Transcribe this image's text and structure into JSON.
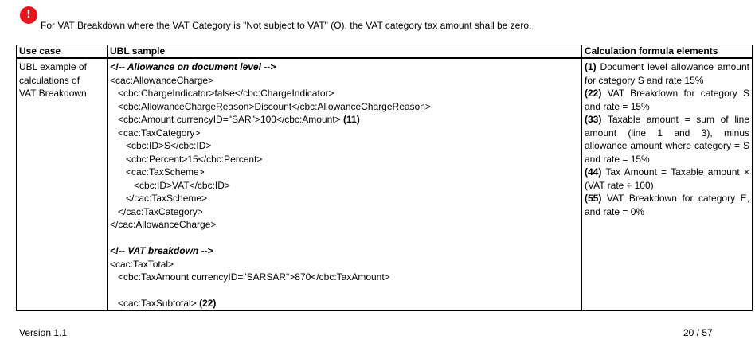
{
  "warning": {
    "icon": "exclamation-icon",
    "color": "#e8141c",
    "text": "For VAT Breakdown where the VAT Category is \"Not subject to VAT\" (O), the VAT category tax amount shall be zero."
  },
  "table": {
    "headers": [
      "Use case",
      "UBL sample",
      "Calculation formula elements"
    ],
    "use_case": [
      "UBL example of",
      "calculations of",
      "VAT Breakdown"
    ],
    "code": [
      {
        "text": "<!-- Allowance on document level -->",
        "style": "comment"
      },
      {
        "text": "<cac:AllowanceCharge>"
      },
      {
        "text": "   <cbc:ChargeIndicator>false</cbc:ChargeIndicator>"
      },
      {
        "text": "   <cbc:AllowanceChargeReason>Discount</cbc:AllowanceChargeReason>"
      },
      {
        "text": "   <cbc:Amount currencyID=\"SAR\">100</cbc:Amount>",
        "ref": " (11)"
      },
      {
        "text": "   <cac:TaxCategory>"
      },
      {
        "text": "      <cbc:ID>S</cbc:ID>"
      },
      {
        "text": "      <cbc:Percent>15</cbc:Percent>"
      },
      {
        "text": "      <cac:TaxScheme>"
      },
      {
        "text": "         <cbc:ID>VAT</cbc:ID>"
      },
      {
        "text": "      </cac:TaxScheme>"
      },
      {
        "text": "   </cac:TaxCategory>"
      },
      {
        "text": "</cac:AllowanceCharge>"
      },
      {
        "text": ""
      },
      {
        "text": "<!-- VAT breakdown -->",
        "style": "comment"
      },
      {
        "text": "<cac:TaxTotal>"
      },
      {
        "text": "   <cbc:TaxAmount currencyID=\"SARSAR\">870</cbc:TaxAmount>"
      },
      {
        "text": ""
      },
      {
        "text": "   <cac:TaxSubtotal>",
        "ref": " (22)"
      }
    ],
    "formulas": [
      {
        "ref": "(1)",
        "text": " Document level allowance amount for category S and rate 15%"
      },
      {
        "ref": "(22)",
        "text": " VAT Breakdown for category S and rate = 15%"
      },
      {
        "ref": "(33)",
        "text": " Taxable amount = sum of line amount (line 1 and 3), minus allowance amount where category = S and rate = 15%"
      },
      {
        "ref": "(44)",
        "text": " Tax Amount = Taxable amount × (VAT rate ÷ 100)"
      },
      {
        "ref": "(55)",
        "text": " VAT Breakdown for category E, and rate = 0%"
      }
    ]
  },
  "footer": {
    "version": "Version 1.1",
    "page": "20 / 57"
  }
}
